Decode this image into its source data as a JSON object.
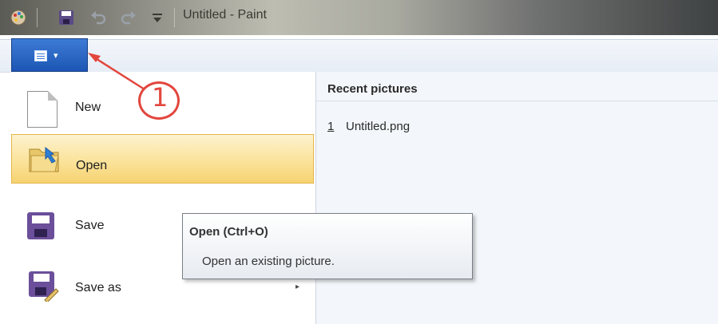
{
  "titlebar": {
    "title": "Untitled - Paint",
    "icons": [
      "paint-app-icon",
      "save-icon",
      "undo-icon",
      "redo-icon",
      "customize-dropdown-icon"
    ]
  },
  "app_menu": {
    "button_icon": "document-icon",
    "caret": "▾"
  },
  "menu": {
    "items": [
      {
        "label": "New",
        "icon": "new-file-icon",
        "state": "normal"
      },
      {
        "label": "Open",
        "icon": "open-folder-icon",
        "state": "highlighted"
      },
      {
        "label": "Save",
        "icon": "floppy-disk-icon",
        "state": "normal"
      },
      {
        "label": "Save as",
        "icon": "save-as-icon",
        "state": "normal",
        "has_submenu": true,
        "arrow": "▸"
      }
    ]
  },
  "recent": {
    "title": "Recent pictures",
    "files": [
      {
        "index": "1",
        "name": "Untitled.png"
      }
    ]
  },
  "tooltip": {
    "title": "Open (Ctrl+O)",
    "description": "Open an existing picture."
  },
  "annotation": {
    "label": "1",
    "color": "#e2463d"
  },
  "colors": {
    "app_button": "#1d56b4",
    "highlight": "#fbe39b",
    "annotation": "#e2463d"
  }
}
